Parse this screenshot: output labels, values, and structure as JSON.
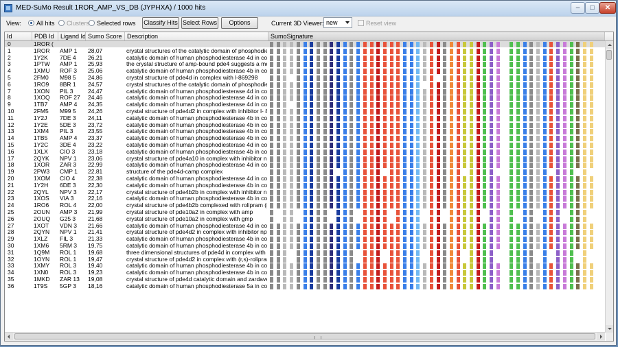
{
  "window": {
    "title": "MED-SuMo Result 1ROR_AMP_VS_DB (JYPHXA) / 1000 hits",
    "min_glyph": "–",
    "max_glyph": "□",
    "close_glyph": "✕"
  },
  "toolbar": {
    "view_label": "View:",
    "opt_all": "All hits",
    "opt_clusters": "Clusters",
    "opt_selected": "Selected rows",
    "classify_label": "Classify Hits",
    "select_rows_label": "Select Rows",
    "options_label": "Options",
    "viewer_label": "Current 3D Viewer:",
    "viewer_value": "new",
    "reset_label": "Reset view"
  },
  "table": {
    "headers": {
      "id": "Id",
      "pdb": "PDB Id",
      "ligand": "Ligand Id",
      "score": "Sumo Score",
      "desc": "Description",
      "sig": "SumoSignature"
    },
    "colors": {
      "a": "#8a8a8a",
      "b": "#b9b9b9",
      "d": "#2d2d7a",
      "n": "#1a3c9e",
      "u": "#3a7fe8",
      "t": "#6fb8f2",
      "r": "#e8533a",
      "R": "#c51d1d",
      "o": "#f08a3a",
      "y": "#c8c83a",
      "Y": "#f0d07a",
      "g": "#4fbf4f",
      "p": "#c87ad8",
      "P": "#8d5fc8",
      "c": "#7a6d4a",
      "m": "#a89aa8"
    },
    "rows": [
      {
        "id": "0",
        "pdb": "1ROR (",
        "ligand": "",
        "score": "",
        "desc": "",
        "sig": "aabbaunaadnuaurrRrrruutbrRaoryyRgPp.gguaburPpgcYY"
      },
      {
        "id": "1",
        "pdb": "1ROR",
        "ligand": "AMP 1",
        "score": "28,07",
        "desc": "crystal structures of the catalytic domain of phosphodies",
        "sig": "aabbaunaadnuaurrRrrruutbrRaoryyRgPp.gguaburPpgcYY"
      },
      {
        "id": "2",
        "pdb": "1Y2K",
        "ligand": "7DE 4",
        "score": "26,21",
        "desc": "catalytic domain of human phosphodiesterase 4d in com",
        "sig": "aabbaunaadnuaurrRrrruutbrRaoryyRgPp.gguaburPpgcYY"
      },
      {
        "id": "3",
        "pdb": "1PTW",
        "ligand": "AMP 1",
        "score": "25,93",
        "desc": "the crystal structure of amp-bound pde4 suggests a mec",
        "sig": "aabbaunaadnuaurrRrrruutbrRaoryyRgPp.gguaburPpgcYY"
      },
      {
        "id": "4",
        "pdb": "1XMU",
        "ligand": "ROF 3",
        "score": "25,06",
        "desc": "catalytic domain of human phosphodiesterase 4b in com",
        "sig": "aabbaunaadnuaurrRrrruutbrRaoryyRgPp.gguaburPpgcYY"
      },
      {
        "id": "5",
        "pdb": "2FM0",
        "ligand": "M98 5",
        "score": "24,86",
        "desc": "crystal structure of pde4d in complex with l-869298",
        "sig": "aab.aunaadnuaurrRrrruutbr.aoryyRgPp.gguaburPpgcYY"
      },
      {
        "id": "6",
        "pdb": "1RO9",
        "ligand": "8BR 1",
        "score": "24,57",
        "desc": "crystal structures of the catalytic domain of phosphodies",
        "sig": "aabbaunaadnuaurrRrrruut.rRaoryyRgPp.gguaburPpgcYY"
      },
      {
        "id": "7",
        "pdb": "1XON",
        "ligand": "PIL 3",
        "score": "24,47",
        "desc": "catalytic domain of human phosphodiesterase 4d in com",
        "sig": "aabbaunaadnuaurrRrrruutbrRaoryyRgPp.gguaburPpgcYY"
      },
      {
        "id": "8",
        "pdb": "1XOQ",
        "ligand": "ROF 27",
        "score": "24,46",
        "desc": "catalytic domain of human phosphodiesterase 4d in com",
        "sig": "aabbaunaadnuaurrRrrruutbrRaoryyRgPp.gguaburPpgcYY"
      },
      {
        "id": "9",
        "pdb": "1TB7",
        "ligand": "AMP 4",
        "score": "24,35",
        "desc": "catalytic domain of human phosphodiesterase 4d in com",
        "sig": "aab.aunaadnuaurrRrrruutbrRaoryyRgPp.gguaburPpgcYY"
      },
      {
        "id": "10",
        "pdb": "2FM5",
        "ligand": "M99 5",
        "score": "24,26",
        "desc": "crystal structure of pde4d2 in complex with inhibitor l- 86",
        "sig": "aabbaunaadnuaurrRrrruutbrRaoryyRgPp.gguaburPpgcYY"
      },
      {
        "id": "11",
        "pdb": "1Y2J",
        "ligand": "7DE 3",
        "score": "24,11",
        "desc": "catalytic domain of human phosphodiesterase 4b in com",
        "sig": "aabbaunaadnuaurrRrrruutbrRaoryyRgPp.gguaburPpgcYY"
      },
      {
        "id": "12",
        "pdb": "1Y2E",
        "ligand": "5DE 3",
        "score": "23,72",
        "desc": "catalytic domain of human phosphodiesterase 4b in com",
        "sig": "aabbaunaadnuaurrRrrruutbrRaoryyRgPp.gguaburPpgcYY"
      },
      {
        "id": "13",
        "pdb": "1XM4",
        "ligand": "PIL 3",
        "score": "23,55",
        "desc": "catalytic domain of human phosphodiesterase 4b in com",
        "sig": "aabbaunaadnuaurrRrrruutbrRaoryyRgPp.gguaburPpgcYY"
      },
      {
        "id": "14",
        "pdb": "1TB5",
        "ligand": "AMP 4",
        "score": "23,37",
        "desc": "catalytic domain of human phosphodiesterase 4b in com",
        "sig": "aabbaunaadnuaurrRrrruutbrRaoryyRgPp.gguaburPpgcYY"
      },
      {
        "id": "15",
        "pdb": "1Y2C",
        "ligand": "3DE 4",
        "score": "23,22",
        "desc": "catalytic domain of human phosphodiesterase 4d in com",
        "sig": "aabbaunaadnuaurrRrrruutbrRaoryyRgPp.gguaburPpgcYY"
      },
      {
        "id": "16",
        "pdb": "1XLX",
        "ligand": "CIO 3",
        "score": "23,18",
        "desc": "catalytic domain of human phosphodiesterase 4b in com",
        "sig": "aabbaunaadnuaurrRrrruutbrRaoryyRgPp.gguaburPpgcYY"
      },
      {
        "id": "17",
        "pdb": "2QYK",
        "ligand": "NPV 1",
        "score": "23,06",
        "desc": "crystal structure of pde4a10 in complex with inhibitor np",
        "sig": "aabbaunaadnuaurrRrrruutbrRaoryyRgPp.gguaburPpgcYY"
      },
      {
        "id": "18",
        "pdb": "1XOR",
        "ligand": "ZAR 3",
        "score": "22,99",
        "desc": "catalytic domain of human phosphodiesterase 4d in com",
        "sig": "aabbaunaadnuaurrRrrruutbrRaoryyRgPp.gguaburPpgcYY"
      },
      {
        "id": "19",
        "pdb": "2PW3",
        "ligand": "CMP 1",
        "score": "22,81",
        "desc": "structure of the pde4d-camp complex",
        "sig": "aabbaunaad.uaurrR.rruutbrRaor.yRgP..gguabu.Ppg.Y."
      },
      {
        "id": "20",
        "pdb": "1XOM",
        "ligand": "CIO 4",
        "score": "22,38",
        "desc": "catalytic domain of human phosphodiesterase 4d in com",
        "sig": "aabbaunaadnuaurrRrrruutbrRaoryyRgPp.gguaburPpgcYY"
      },
      {
        "id": "21",
        "pdb": "1Y2H",
        "ligand": "6DE 3",
        "score": "22,30",
        "desc": "catalytic domain of human phosphodiesterase 4b in com",
        "sig": "aabbaunaadnuaurrRrrruutbrRaoryyRgPp.gguaburPpgcYY"
      },
      {
        "id": "22",
        "pdb": "2QYL",
        "ligand": "NPV 3",
        "score": "22,17",
        "desc": "crystal structure of pde4b2b in complex with inhibitor np",
        "sig": "aabbaunaadnuaurrRrrruutbrRaoryyRgPp.gguaburPpgcYY"
      },
      {
        "id": "23",
        "pdb": "1XOS",
        "ligand": "VIA 3",
        "score": "22,16",
        "desc": "catalytic domain of human phosphodiesterase 4b in com",
        "sig": "aabbaunaadnuaurrRrrruutbrRaoryyRgPp.gguaburPpgcYY"
      },
      {
        "id": "24",
        "pdb": "1RO6",
        "ligand": "ROL 4",
        "score": "22,00",
        "desc": "crystal structure of pde4b2b complexed with rolipram (r",
        "sig": "aabbaunaadnuaurrRrrruutbrRaoryyRgPp.gguaburPpgcYY"
      },
      {
        "id": "25",
        "pdb": "2OUN",
        "ligand": "AMP 3",
        "score": "21,99",
        "desc": "crystal structure of pde10a2 in complex with amp",
        "sig": "a.bb.unaa.nua.rrRr.ruut.rR.oryyR.Pp.g.ua.urP.gcY."
      },
      {
        "id": "26",
        "pdb": "2OUQ",
        "ligand": "G25 3",
        "score": "21,68",
        "desc": "crystal structure of pde10a2 in complex with gmp",
        "sig": "a.bb.unaa.nua.rrRr.ruut.rR.oryyR.Pp.g.ua.urP.gcY."
      },
      {
        "id": "27",
        "pdb": "1XOT",
        "ligand": "VDN 3",
        "score": "21,66",
        "desc": "catalytic domain of human phosphodiesterase 4d in com",
        "sig": "aabbaunaadnuaurrRrrruutbrRaoryyRgPp.gguaburPpgcYY"
      },
      {
        "id": "28",
        "pdb": "2QYN",
        "ligand": "NPV 1",
        "score": "21,41",
        "desc": "crystal structure of pde4d2 in complex with inhibitor npv",
        "sig": "aabbaunaadnuaurrRrrruutbrRaoryyRgPp.gguaburPpgcYY"
      },
      {
        "id": "29",
        "pdb": "1XLZ",
        "ligand": "FIL 3",
        "score": "21,33",
        "desc": "catalytic domain of human phosphodiesterase 4b in com",
        "sig": "aabbaunaadnuaurrRrrruutbrRaoryyRgPp.gguaburPpgcYY"
      },
      {
        "id": "30",
        "pdb": "1XM6",
        "ligand": "5RM 3",
        "score": "19,75",
        "desc": "catalytic domain of human phosphodiesterase 4b in com",
        "sig": "aabbaunaadnuaurrRrrruutbrRaoryyRgPp.gguaburPpgcYY"
      },
      {
        "id": "31",
        "pdb": "1Q9M",
        "ligand": "ROL 1",
        "score": "19,68",
        "desc": "three dimensional structures of pde4d in complex with r",
        "sig": "aab.aunaadnua.rrR.rruut.rRaor.yRgP..ggua.u.Ppg.Y."
      },
      {
        "id": "32",
        "pdb": "1OYN",
        "ligand": "ROL 1",
        "score": "19,47",
        "desc": "crystal structure of pde4d2 in complex with (r,s)-rolipram",
        "sig": "aab.aunaadnua.rrR.rruut.rRaor.yRgP..ggua.u.Ppg.Y."
      },
      {
        "id": "33",
        "pdb": "1XMY",
        "ligand": "ROL 3",
        "score": "19,40",
        "desc": "catalytic domain of human phosphodiesterase 4b in com",
        "sig": "aabbaunaadnuaurrRrrruutbrRaoryyRgPp.gguaburPpgcYY"
      },
      {
        "id": "34",
        "pdb": "1XN0",
        "ligand": "ROL 3",
        "score": "19,23",
        "desc": "catalytic domain of human phosphodiesterase 4b in com",
        "sig": "aabbaunaadnuaurrRrrruutbrRaoryyRgPp.gguaburPpgcYY"
      },
      {
        "id": "35",
        "pdb": "1MKD",
        "ligand": "ZAR 13",
        "score": "19,08",
        "desc": "crystal structure of pde4d catalytic domain and zardaver",
        "sig": "aabbaunaadnuaurrRrrruutbrRaoryyRgPp.gguaburPpgcYY"
      },
      {
        "id": "36",
        "pdb": "1T9S",
        "ligand": "5GP 3",
        "score": "18,16",
        "desc": "catalytic domain of human phosphodiesterase 5a in com",
        "sig": "aabbaunaadnuaurrRrrruutbrRaoryyRgPp.gguaburPpgcYY"
      }
    ]
  }
}
